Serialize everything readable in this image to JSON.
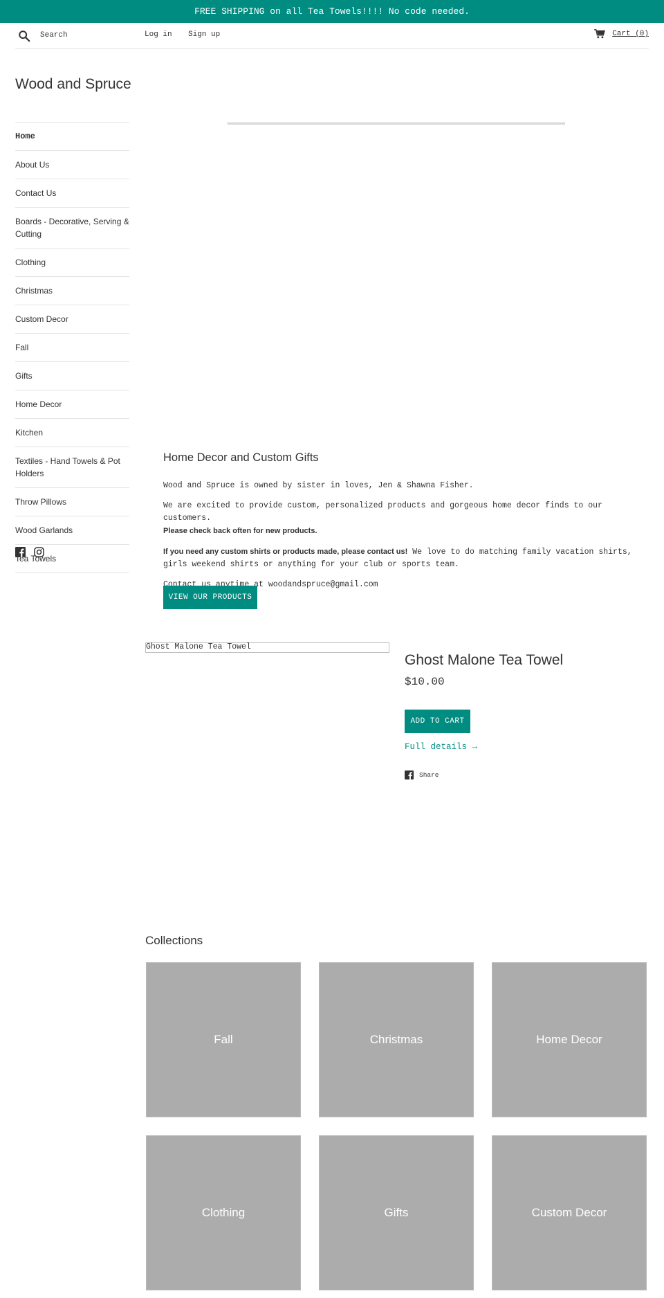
{
  "announcement": {
    "text": "FREE SHIPPING on all Tea Towels!!!! No code needed."
  },
  "header": {
    "search_icon": "search-icon",
    "search_placeholder": "Search",
    "login_label": "Log in",
    "signup_label": "Sign up",
    "cart_icon": "cart-icon",
    "cart_label": "Cart (0)"
  },
  "site": {
    "title": "Wood and Spruce"
  },
  "sidebar": {
    "items": [
      {
        "label": "Home",
        "active": true
      },
      {
        "label": "About Us"
      },
      {
        "label": "Contact Us"
      },
      {
        "label": "Boards - Decorative, Serving & Cutting"
      },
      {
        "label": "Clothing"
      },
      {
        "label": "Christmas"
      },
      {
        "label": "Custom Decor"
      },
      {
        "label": "Fall"
      },
      {
        "label": "Gifts"
      },
      {
        "label": "Home Decor"
      },
      {
        "label": "Kitchen"
      },
      {
        "label": "Textiles - Hand Towels & Pot Holders"
      },
      {
        "label": "Throw Pillows"
      },
      {
        "label": "Wood Garlands"
      },
      {
        "label": "Tea Towels"
      }
    ],
    "social": [
      "facebook-icon",
      "instagram-icon"
    ]
  },
  "welcome": {
    "heading": "Home Decor and Custom Gifts",
    "p1": "Wood and Spruce is owned by sister in loves, Jen & Shawna Fisher.",
    "p2": "We are excited to provide custom, personalized products and gorgeous home decor finds to our customers.",
    "p2_bold": "Please check back often for new products.",
    "p3_bold": "If you need any custom shirts or products made, please contact us!",
    "p3": " We love to do matching family vacation shirts, girls weekend shirts or anything for your club or sports team.",
    "p4": "Contact us anytime at woodandspruce@gmail.com",
    "button_label": "VIEW OUR PRODUCTS"
  },
  "featured_product": {
    "image_alt": "Ghost Malone Tea Towel",
    "title": "Ghost Malone Tea Towel",
    "price": "$10.00",
    "add_to_cart_label": "ADD TO CART",
    "full_details_label": "Full details →",
    "share_label": "Share"
  },
  "collections": {
    "title": "Collections",
    "items": [
      {
        "label": "Fall"
      },
      {
        "label": "Christmas"
      },
      {
        "label": "Home Decor"
      },
      {
        "label": "Clothing"
      },
      {
        "label": "Gifts"
      },
      {
        "label": "Custom Decor"
      }
    ]
  },
  "colors": {
    "brand": "#008c81",
    "tile": "#acacac",
    "text": "#333333",
    "border": "#e4e4e4"
  }
}
